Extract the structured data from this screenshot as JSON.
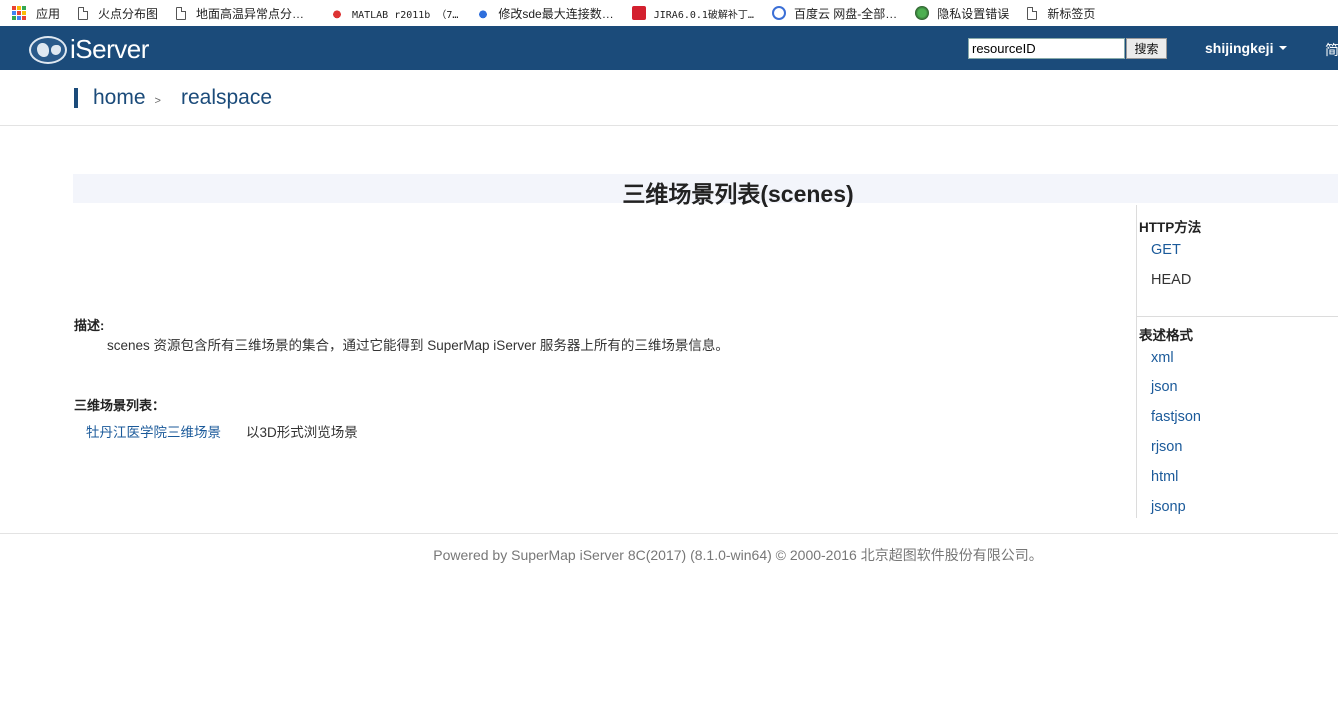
{
  "bookmarks": [
    {
      "label": "应用",
      "icon": "apps-grid-icon"
    },
    {
      "label": "火点分布图",
      "icon": "page-icon"
    },
    {
      "label": "地面高温异常点分…",
      "icon": "page-icon"
    },
    {
      "label": "MATLAB r2011b （7…",
      "icon": "baidu-paw-icon"
    },
    {
      "label": "修改sde最大连接数…",
      "icon": "baidu-paw-icon"
    },
    {
      "label": "JIRA6.0.1破解补丁…",
      "icon": "c-logo-icon"
    },
    {
      "label": "百度云 网盘-全部…",
      "icon": "baidu-cloud-icon"
    },
    {
      "label": "隐私设置错误",
      "icon": "globe-icon"
    },
    {
      "label": "新标签页",
      "icon": "page-icon"
    }
  ],
  "header": {
    "logo_prefix": "i",
    "logo_main": "Server",
    "search_value": "resourceID",
    "search_button": "搜索",
    "user": "shijingkeji",
    "lang": "简",
    "bg_color": "#1b4b7a"
  },
  "breadcrumb": {
    "home": "home",
    "separator": ">",
    "current": "realspace"
  },
  "main": {
    "title": "三维场景列表(scenes)",
    "desc_label": "描述:",
    "desc_text": "scenes 资源包含所有三维场景的集合，通过它能得到 SuperMap iServer 服务器上所有的三维场景信息。",
    "list_label": "三维场景列表：",
    "scenes": [
      {
        "name": "牡丹江医学院三维场景",
        "view_3d": "以3D形式浏览场景"
      }
    ]
  },
  "sidebar": {
    "http_heading": "HTTP方法",
    "http_methods": [
      "GET",
      "HEAD"
    ],
    "format_heading": "表述格式",
    "formats": [
      "xml",
      "json",
      "fastjson",
      "rjson",
      "html",
      "jsonp"
    ]
  },
  "footer": {
    "text": "Powered by SuperMap iServer 8C(2017) (8.1.0-win64) © 2000-2016 北京超图软件股份有限公司。"
  }
}
